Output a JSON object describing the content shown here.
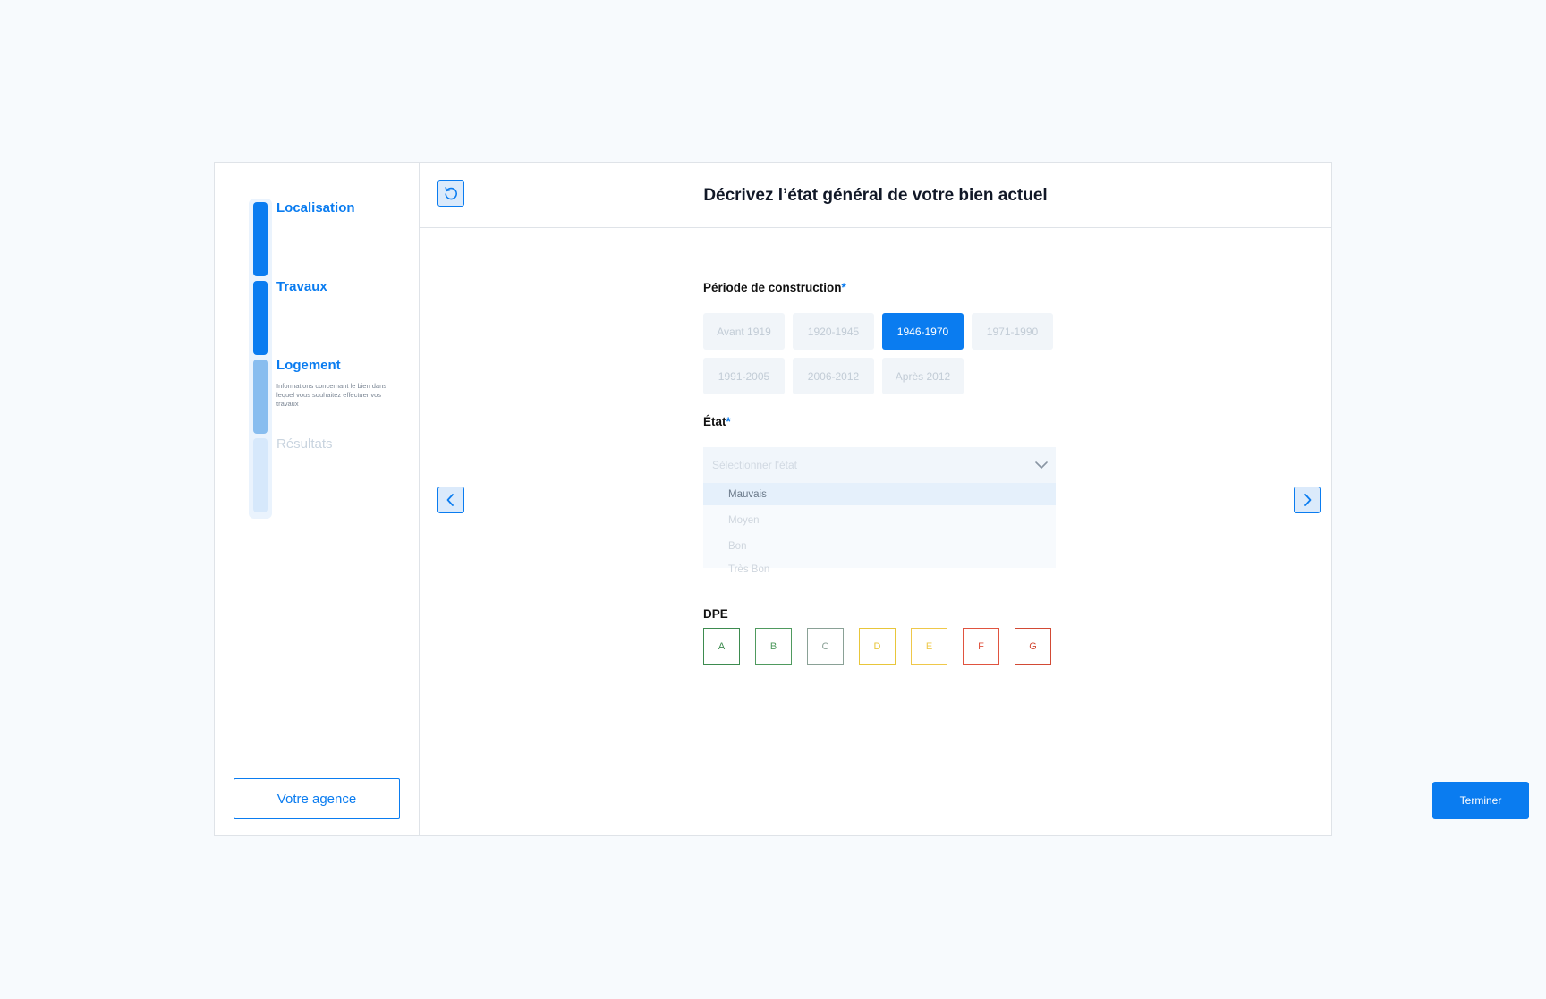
{
  "sidebar": {
    "steps": [
      {
        "label": "Localisation"
      },
      {
        "label": "Travaux"
      },
      {
        "label": "Logement",
        "description": "Informations concernant le bien dans lequel vous souhaitez effectuer vos travaux"
      },
      {
        "label": "Résultats"
      }
    ],
    "agency_button": "Votre agence"
  },
  "header": {
    "title": "Décrivez l’état général de votre bien actuel"
  },
  "form": {
    "period": {
      "label": "Période de construction",
      "required_mark": "*",
      "options": [
        "Avant 1919",
        "1920-1945",
        "1946-1970",
        "1971-1990",
        "1991-2005",
        "2006-2012",
        "Après 2012"
      ],
      "selected": "1946-1970"
    },
    "etat": {
      "label": "État",
      "required_mark": "*",
      "placeholder": "Sélectionner l'état",
      "options": [
        "Mauvais",
        "Moyen",
        "Bon",
        "Très Bon"
      ],
      "highlighted": "Mauvais"
    },
    "dpe": {
      "label": "DPE",
      "grades": [
        {
          "letter": "A",
          "color": "#3d8b4f"
        },
        {
          "letter": "B",
          "color": "#4f9a5e"
        },
        {
          "letter": "C",
          "color": "#8aa196"
        },
        {
          "letter": "D",
          "color": "#e8c63a"
        },
        {
          "letter": "E",
          "color": "#efc84a"
        },
        {
          "letter": "F",
          "color": "#e0533f"
        },
        {
          "letter": "G",
          "color": "#d24a35"
        }
      ]
    }
  },
  "footer": {
    "finish_label": "Terminer"
  },
  "icons": {
    "reset": "reset-icon",
    "prev": "chevron-left-icon",
    "next": "chevron-right-icon",
    "dropdown": "chevron-down-icon"
  },
  "colors": {
    "accent": "#0a7cf0",
    "background": "#f7fafd"
  }
}
